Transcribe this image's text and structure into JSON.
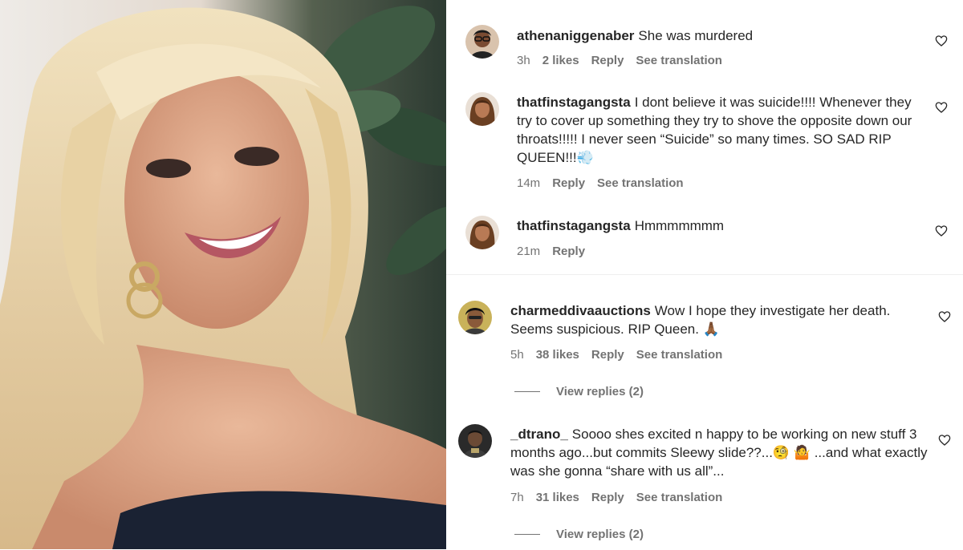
{
  "comments_top": [
    {
      "username": "athenaniggenaber",
      "text": "She was murdered",
      "time": "3h",
      "likes": "2 likes",
      "reply_label": "Reply",
      "translate_label": "See translation",
      "avatar_icon": "avatar-woman-glasses"
    },
    {
      "username": "thatfinstagangsta",
      "text": "I dont believe it was suicide!!!! Whenever they try to cover up something they try to shove the opposite down our throats!!!!! I never seen “Suicide” so many times. SO SAD RIP QUEEN!!!💨",
      "time": "14m",
      "reply_label": "Reply",
      "translate_label": "See translation",
      "avatar_icon": "avatar-woman-hair"
    },
    {
      "username": "thatfinstagangsta",
      "text": "Hmmmmmmm",
      "time": "21m",
      "reply_label": "Reply",
      "avatar_icon": "avatar-woman-hair"
    }
  ],
  "comments_bottom": [
    {
      "username": "charmeddivaauctions",
      "text": "Wow I hope they investigate her death. Seems suspicious. RIP Queen. 🙏🏾",
      "time": "5h",
      "likes": "38 likes",
      "reply_label": "Reply",
      "translate_label": "See translation",
      "view_replies": "View replies (2)",
      "avatar_icon": "avatar-woman-short-hair"
    },
    {
      "username": "_dtrano_",
      "text": "Soooo shes excited n happy to be working on new stuff 3 months ago...but commits Sleewy slide??...🧐 🤷 ...and what exactly was she gonna “share with us all”...",
      "time": "7h",
      "likes": "31 likes",
      "reply_label": "Reply",
      "translate_label": "See translation",
      "view_replies": "View replies (2)",
      "avatar_icon": "avatar-man-dark"
    }
  ],
  "icons": {
    "like": "heart-outline-icon"
  },
  "colors": {
    "text": "#262626",
    "secondary": "#737373",
    "background": "#ffffff"
  }
}
